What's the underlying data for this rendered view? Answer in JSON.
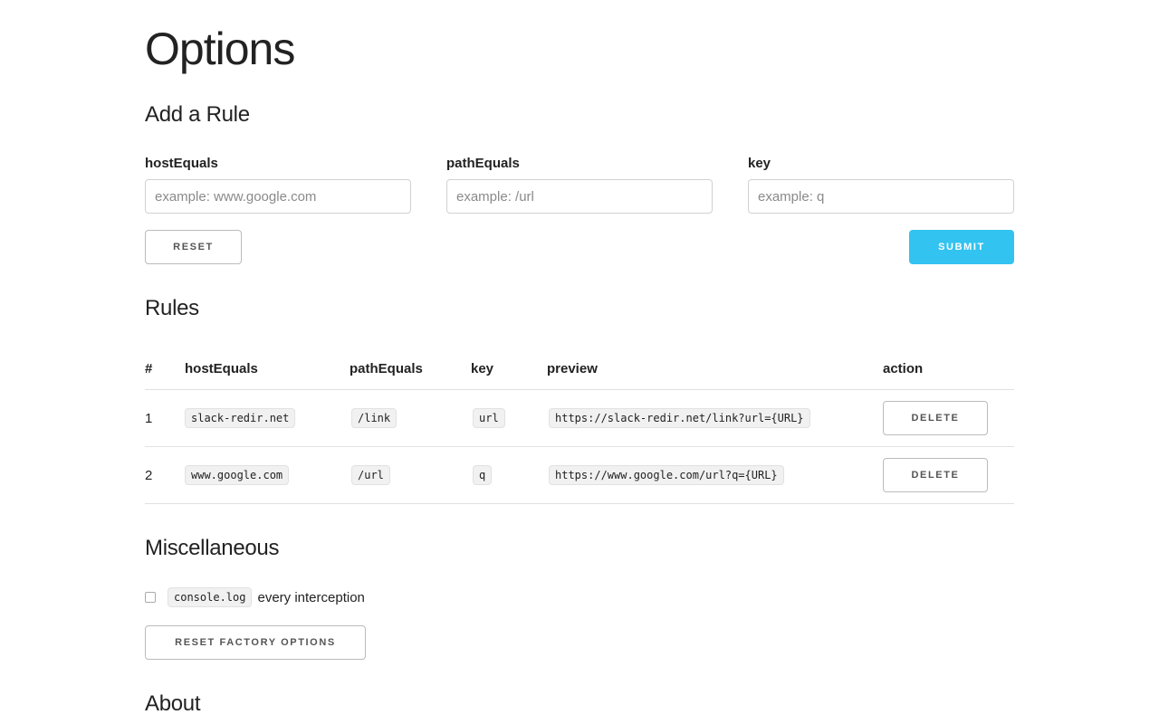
{
  "page": {
    "title": "Options"
  },
  "add_rule": {
    "heading": "Add a Rule",
    "fields": [
      {
        "label": "hostEquals",
        "placeholder": "example: www.google.com",
        "value": ""
      },
      {
        "label": "pathEquals",
        "placeholder": "example: /url",
        "value": ""
      },
      {
        "label": "key",
        "placeholder": "example: q",
        "value": ""
      }
    ],
    "reset_label": "RESET",
    "submit_label": "SUBMIT"
  },
  "rules": {
    "heading": "Rules",
    "columns": [
      "#",
      "hostEquals",
      "pathEquals",
      "key",
      "preview",
      "action"
    ],
    "rows": [
      {
        "index": "1",
        "host": "slack-redir.net",
        "path": "/link",
        "key": "url",
        "preview": "https://slack-redir.net/link?url={URL}",
        "action": "DELETE"
      },
      {
        "index": "2",
        "host": "www.google.com",
        "path": "/url",
        "key": "q",
        "preview": "https://www.google.com/url?q={URL}",
        "action": "DELETE"
      }
    ]
  },
  "misc": {
    "heading": "Miscellaneous",
    "checkbox_checked": false,
    "checkbox_code": "console.log",
    "checkbox_text": "every interception",
    "reset_factory_label": "RESET FACTORY OPTIONS"
  },
  "about": {
    "heading": "About"
  },
  "colors": {
    "primary": "#33c3f0",
    "text": "#222222",
    "border": "#d1d1d1"
  }
}
